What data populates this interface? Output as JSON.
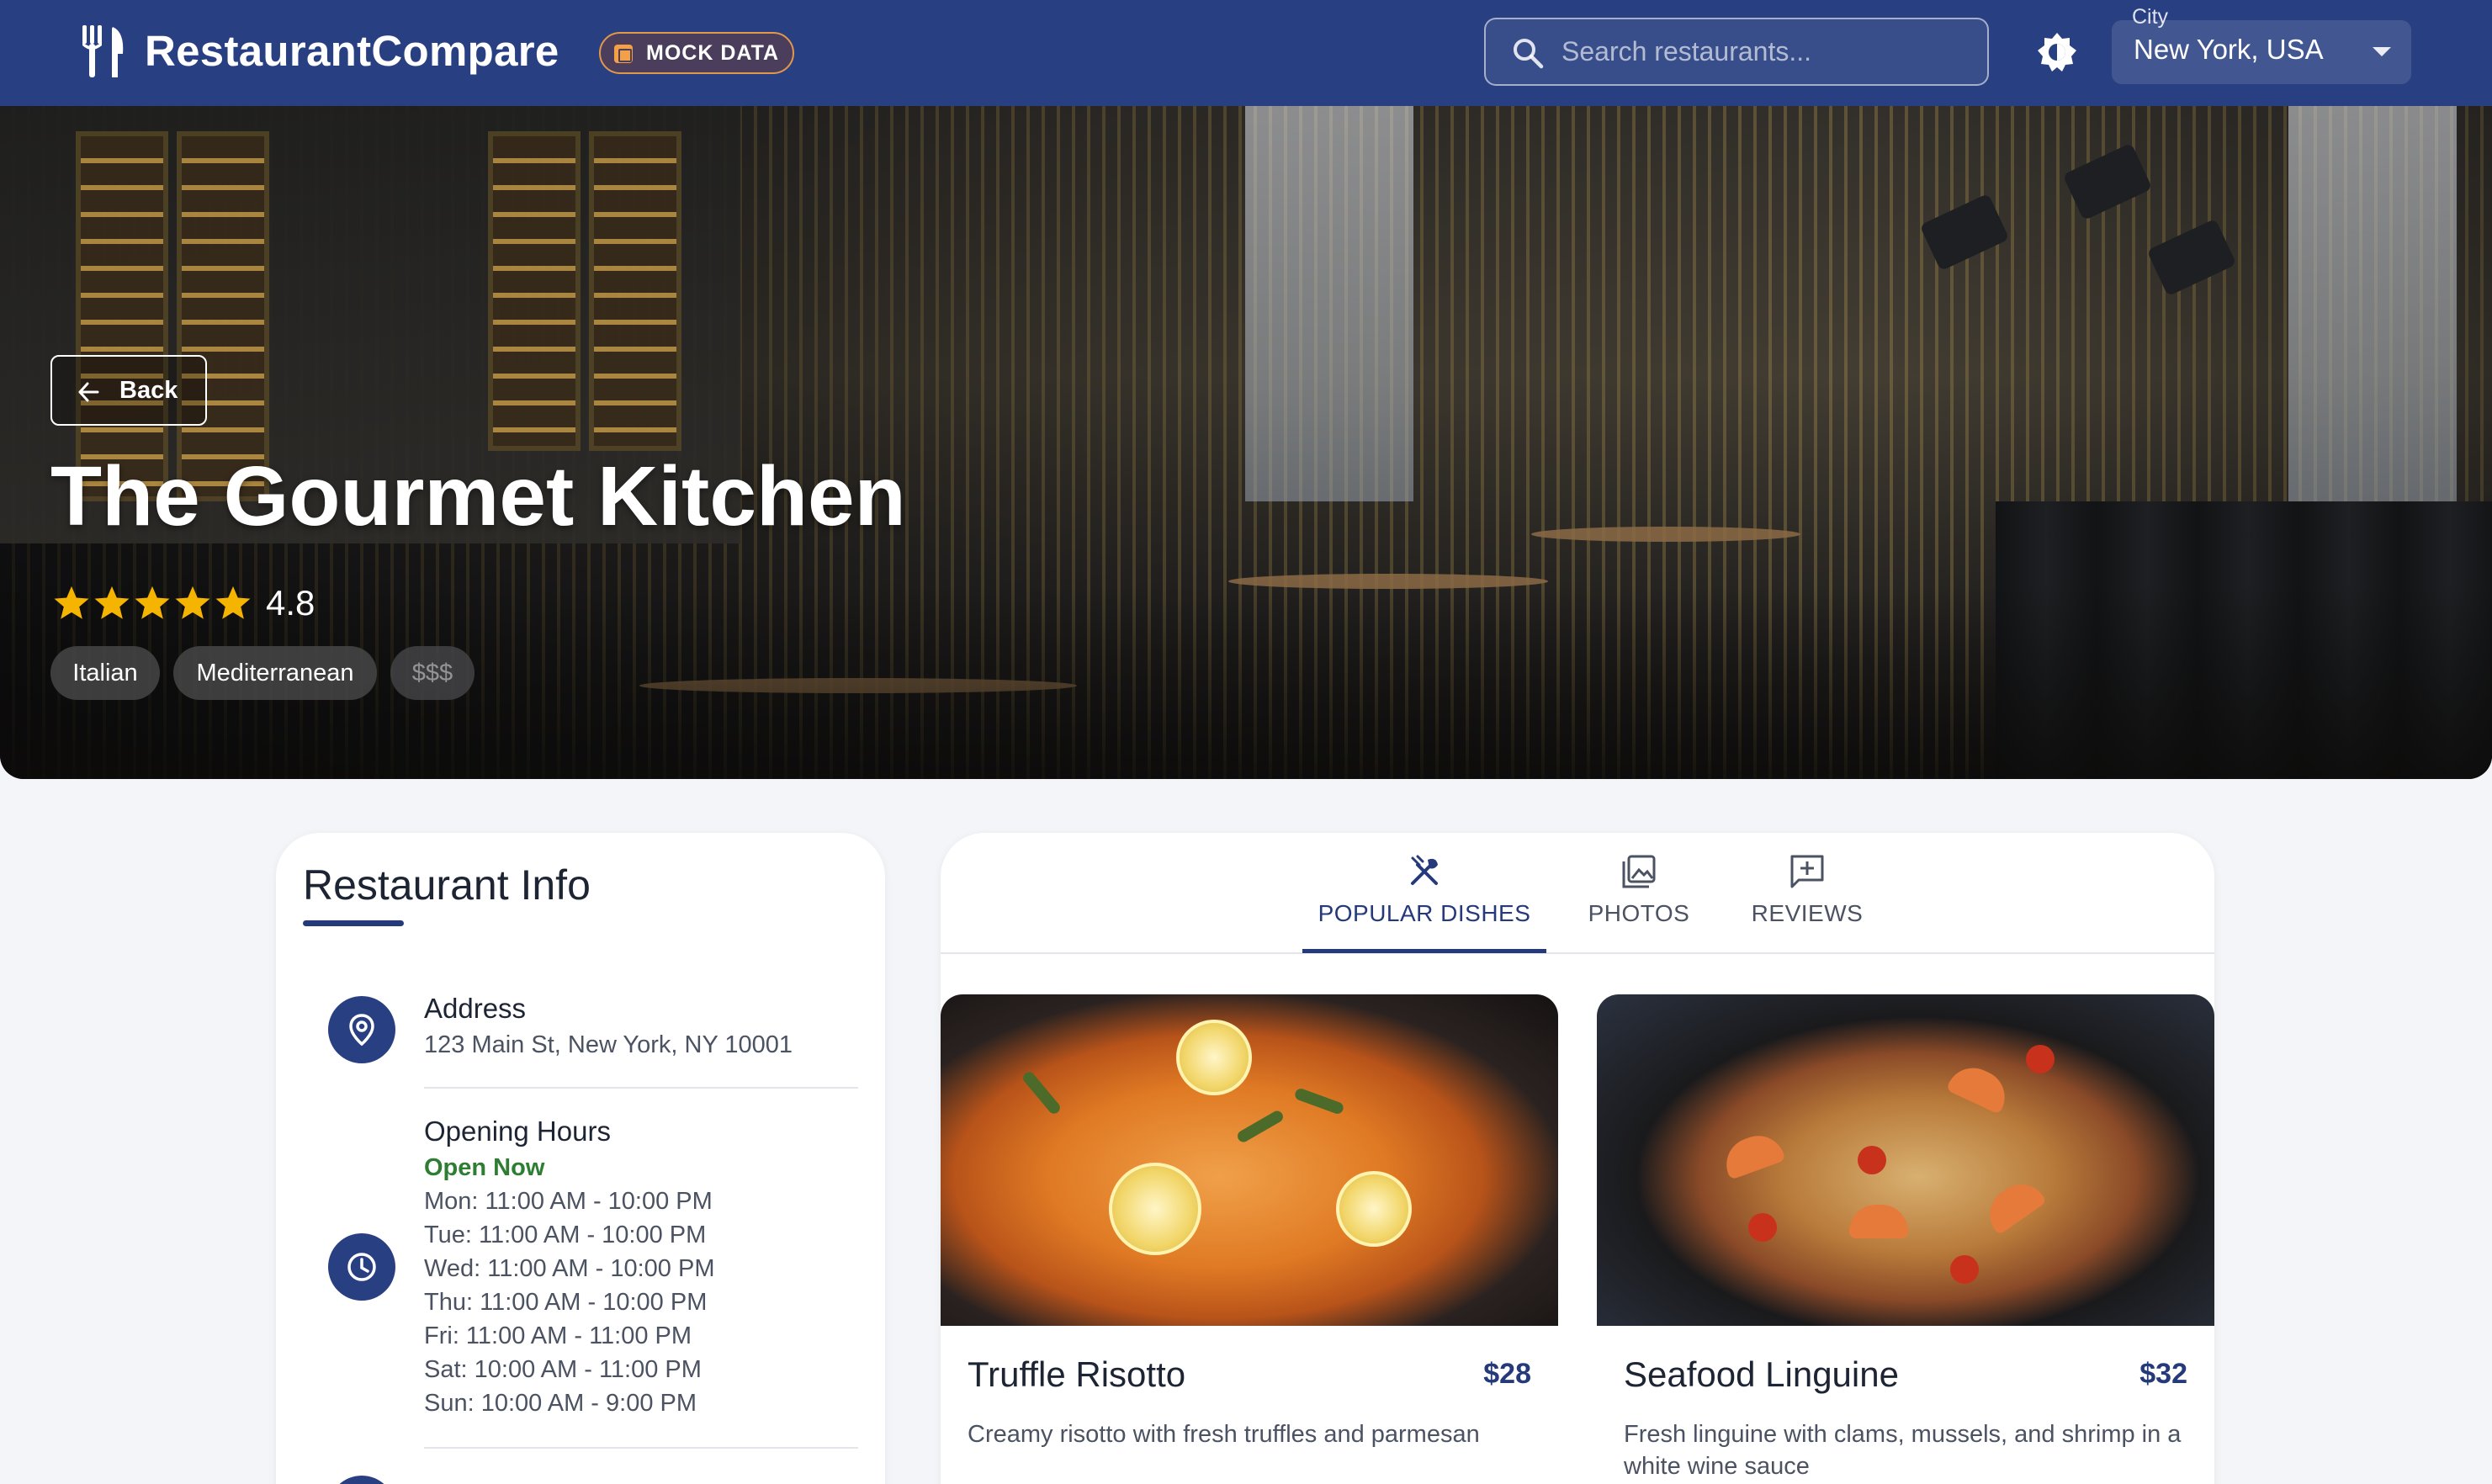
{
  "header": {
    "app_name": "RestaurantCompare",
    "mock_badge": "MOCK DATA",
    "search_placeholder": "Search restaurants...",
    "city_label": "City",
    "city_value": "New York, USA",
    "icons": {
      "logo": "fork-knife-icon",
      "badge": "grid-icon",
      "search": "search-icon",
      "theme": "brightness-icon",
      "dropdown": "chevron-down-icon"
    },
    "colors": {
      "primary": "#283f82",
      "badge_accent": "#f4a046"
    }
  },
  "hero": {
    "back_label": "Back",
    "restaurant_name": "The Gourmet Kitchen",
    "rating": "4.8",
    "stars_filled": 5,
    "star_color": "#f5b400",
    "tags": [
      "Italian",
      "Mediterranean",
      "$$$"
    ]
  },
  "info": {
    "title": "Restaurant Info",
    "address": {
      "label": "Address",
      "value": "123 Main St, New York, NY 10001",
      "icon": "location-pin-icon"
    },
    "hours": {
      "label": "Opening Hours",
      "status": "Open Now",
      "status_color": "#2e7d32",
      "icon": "clock-icon",
      "lines": [
        "Mon: 11:00 AM - 10:00 PM",
        "Tue: 11:00 AM - 10:00 PM",
        "Wed: 11:00 AM - 10:00 PM",
        "Thu: 11:00 AM - 10:00 PM",
        "Fri: 11:00 AM - 11:00 PM",
        "Sat: 10:00 AM - 11:00 PM",
        "Sun: 10:00 AM - 9:00 PM"
      ]
    }
  },
  "tabs": [
    {
      "label": "POPULAR DISHES",
      "icon": "utensils-crossed-icon",
      "active": true
    },
    {
      "label": "PHOTOS",
      "icon": "photo-library-icon",
      "active": false
    },
    {
      "label": "REVIEWS",
      "icon": "rate-review-icon",
      "active": false
    }
  ],
  "dishes": [
    {
      "name": "Truffle Risotto",
      "price": "$28",
      "description": "Creamy risotto with fresh truffles and parmesan"
    },
    {
      "name": "Seafood Linguine",
      "price": "$32",
      "description": "Fresh linguine with clams, mussels, and shrimp in a white wine sauce"
    }
  ]
}
